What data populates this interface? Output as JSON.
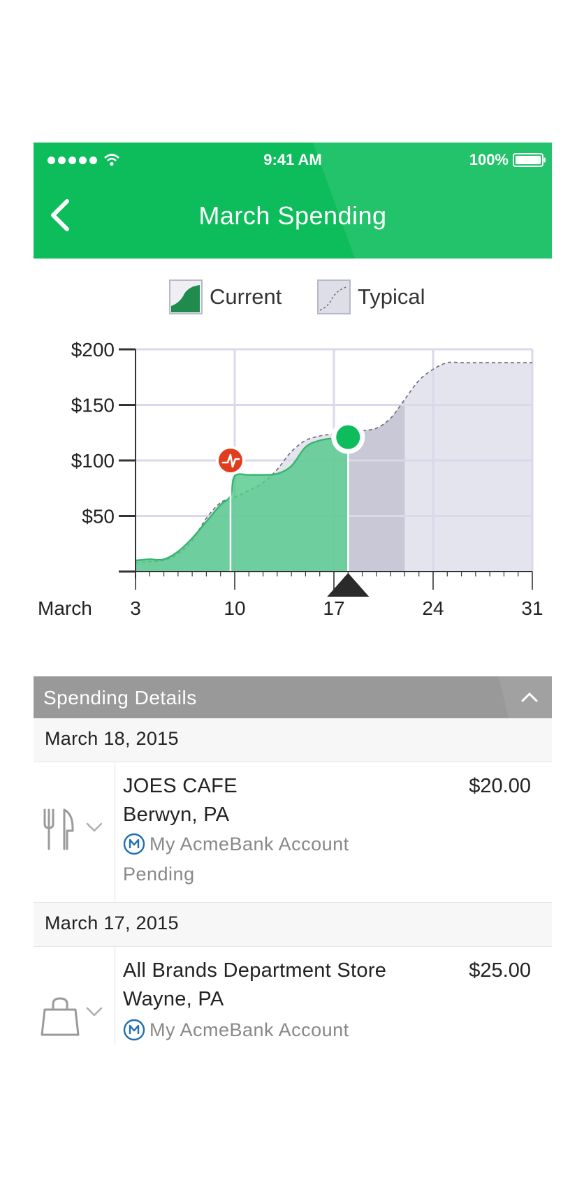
{
  "status_bar": {
    "time": "9:41 AM",
    "battery": "100%"
  },
  "nav": {
    "title": "March Spending"
  },
  "legend": {
    "current": "Current",
    "typical": "Typical"
  },
  "colors": {
    "brand_green": "#0dbd5c",
    "current_fill": "#55c98b",
    "typical_fill": "#e4e4ee",
    "projected_fill": "#c8c8d6",
    "alert_red": "#e03d1e"
  },
  "icons": {
    "back": "chevron-left-icon",
    "collapse": "chevron-up-icon",
    "expand": "chevron-down-icon",
    "dining": "fork-knife-icon",
    "shopping": "shopping-bag-icon",
    "bank": "acmebank-logo-icon",
    "alert": "alert-pulse-icon"
  },
  "chart_data": {
    "type": "area",
    "x_label_prefix": "March",
    "x_ticks": [
      "3",
      "10",
      "17",
      "24",
      "31"
    ],
    "x_tick_values": [
      3,
      10,
      17,
      24,
      31
    ],
    "y_ticks": [
      "$200",
      "$150",
      "$100",
      "$50"
    ],
    "y_tick_values": [
      200,
      150,
      100,
      50
    ],
    "ylim": [
      0,
      200
    ],
    "xlim": [
      3,
      31
    ],
    "grid": true,
    "series": [
      {
        "name": "Current",
        "x": [
          3,
          4,
          5,
          6,
          7,
          8,
          9,
          9.7,
          10,
          11,
          12,
          13,
          14,
          15,
          16,
          17,
          18
        ],
        "y": [
          10,
          11,
          11,
          18,
          30,
          45,
          60,
          68,
          86,
          87,
          87,
          88,
          95,
          112,
          118,
          120,
          121
        ]
      },
      {
        "name": "Typical",
        "x": [
          3,
          4,
          5,
          6,
          7,
          8,
          9,
          10,
          11,
          12,
          13,
          14,
          15,
          16,
          17,
          18,
          19,
          20,
          21,
          22,
          23,
          24,
          25,
          26,
          27,
          28,
          29,
          30,
          31
        ],
        "y": [
          8,
          9,
          10,
          16,
          28,
          48,
          62,
          67,
          73,
          80,
          92,
          108,
          118,
          122,
          124,
          126,
          127,
          129,
          138,
          155,
          172,
          182,
          188,
          188,
          188,
          188,
          188,
          188,
          188
        ]
      }
    ],
    "projected_until": 22,
    "selected_day": 18,
    "alert_day": 9.7,
    "alert_value": 100
  },
  "details": {
    "title": "Spending Details"
  },
  "groups": [
    {
      "date": "March 18, 2015",
      "transactions": [
        {
          "merchant": "JOES CAFE",
          "location": "Berwyn, PA",
          "amount": "$20.00",
          "account": "My AcmeBank Account",
          "status": "Pending"
        }
      ]
    },
    {
      "date": "March 17, 2015",
      "transactions": [
        {
          "merchant": "All Brands Department Store",
          "location": "Wayne, PA",
          "amount": "$25.00",
          "account": "My AcmeBank Account",
          "status": ""
        }
      ]
    }
  ]
}
